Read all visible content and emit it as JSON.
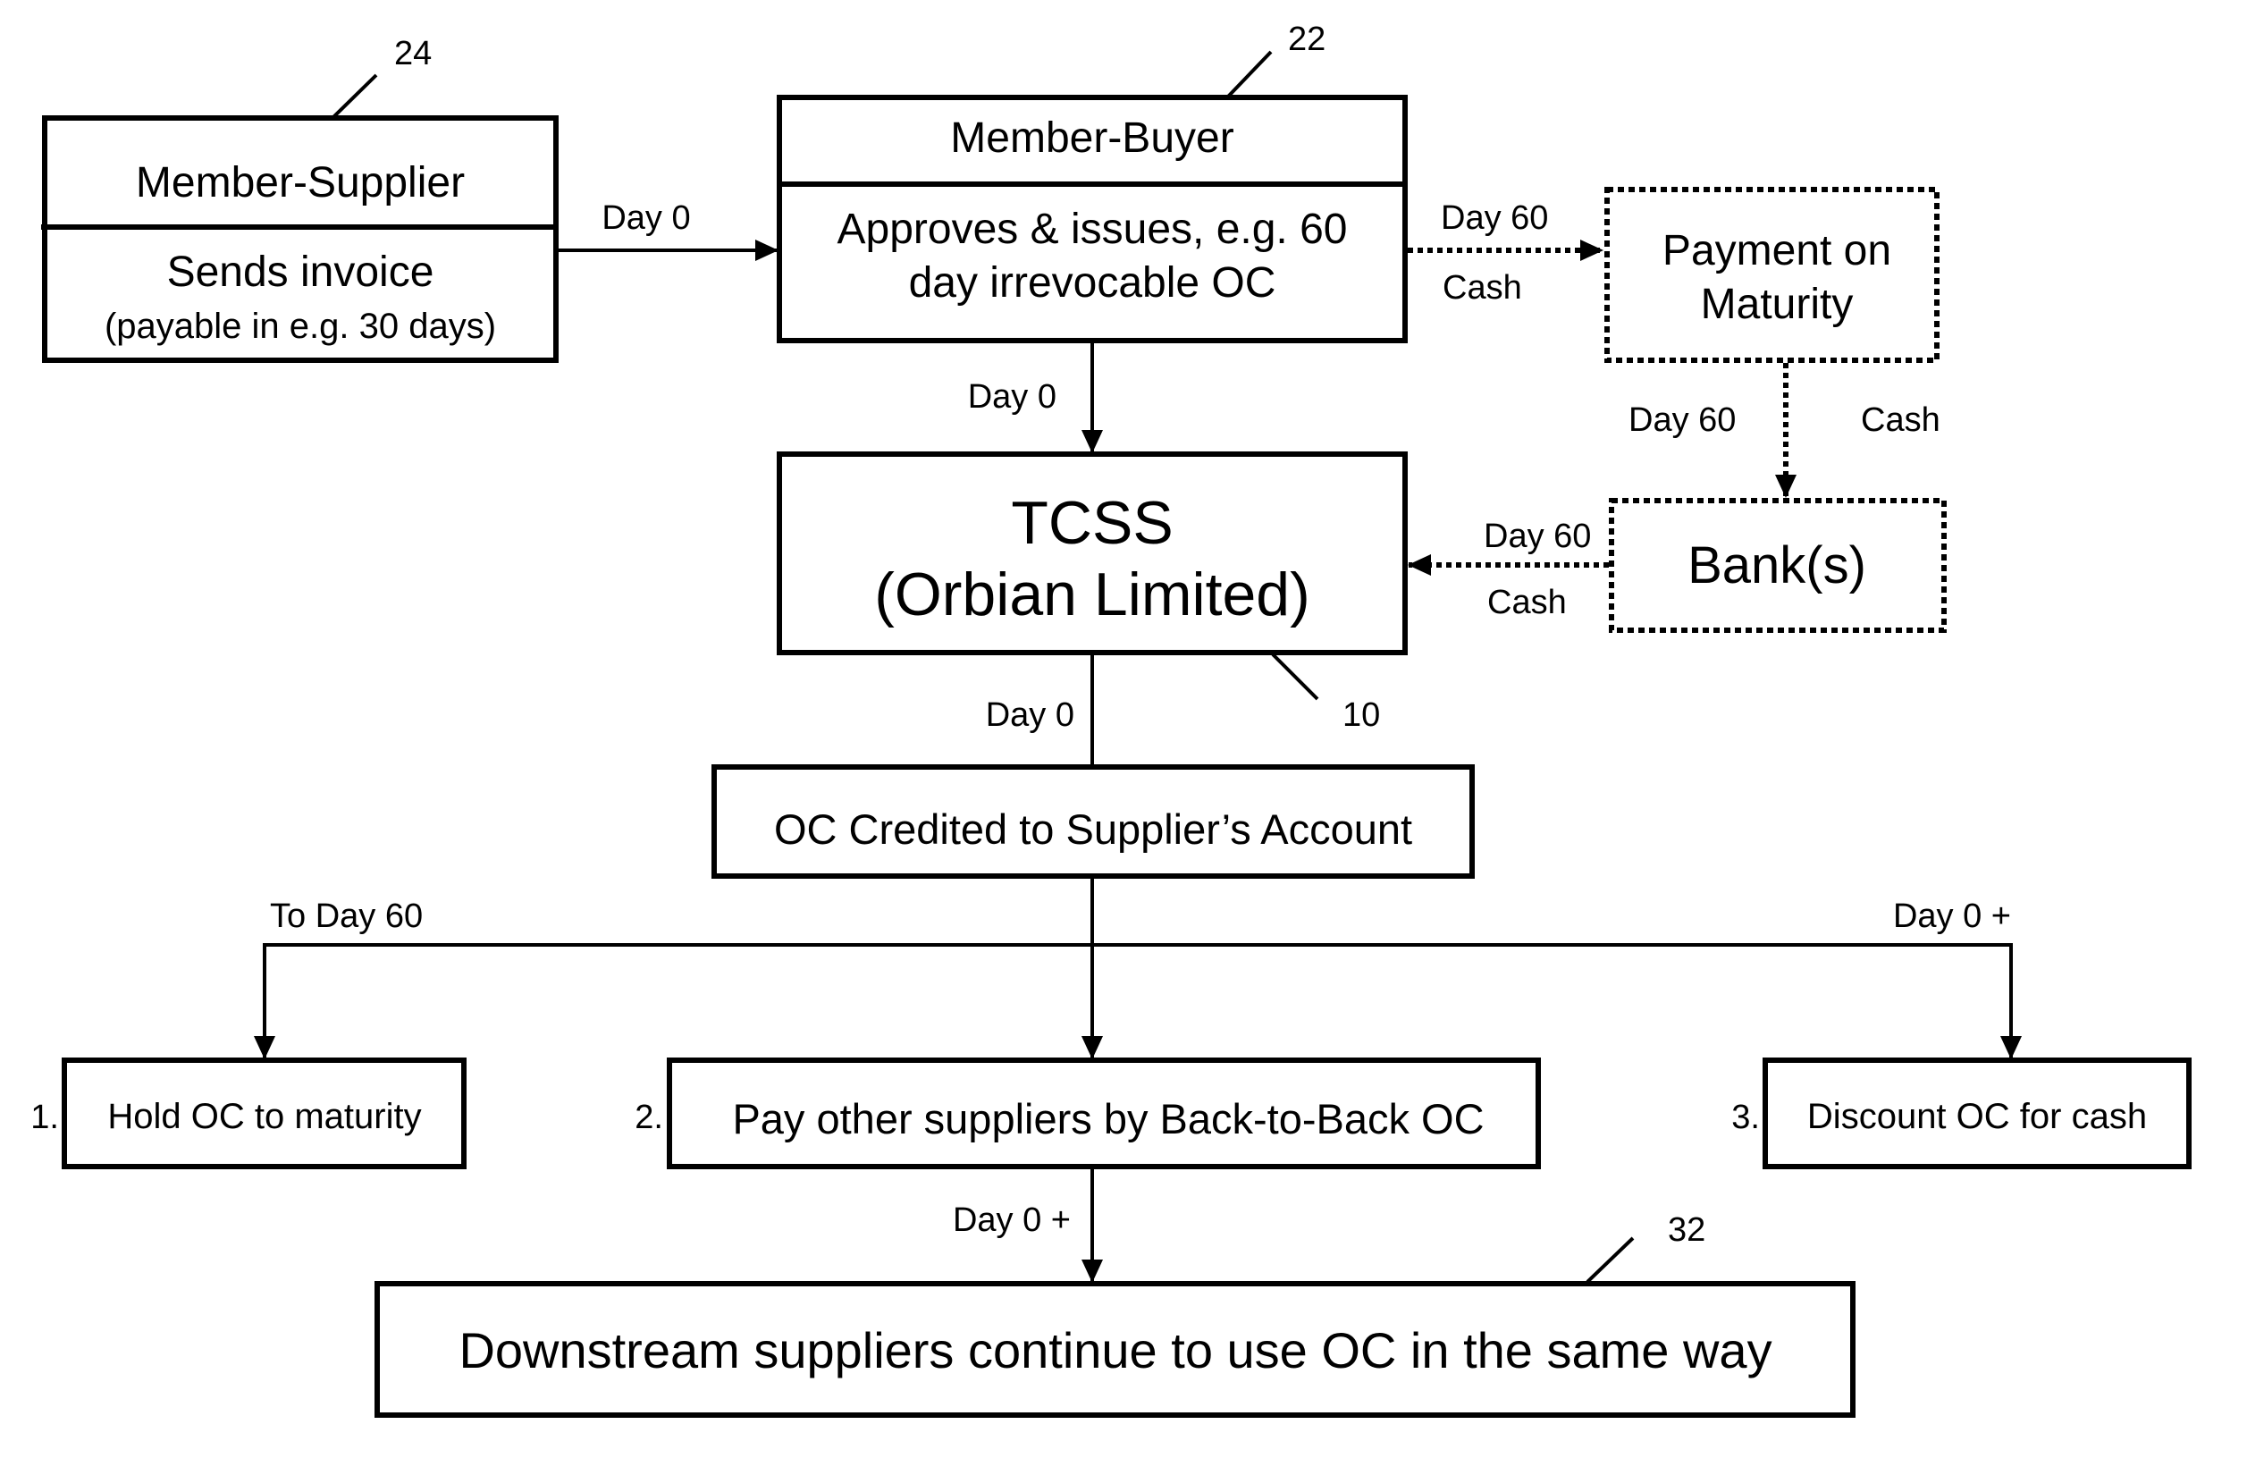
{
  "diagram": {
    "colors": {
      "ink": "#000000",
      "background": "#ffffff"
    },
    "nodes": {
      "supplier": {
        "ref": "24",
        "title": "Member-Supplier",
        "line1": "Sends invoice",
        "line2": "(payable in e.g. 30 days)"
      },
      "buyer": {
        "ref": "22",
        "title": "Member-Buyer",
        "line1": "Approves & issues, e.g. 60",
        "line2": "day irrevocable OC"
      },
      "payment": {
        "line1": "Payment on",
        "line2": "Maturity"
      },
      "banks": {
        "label": "Bank(s)"
      },
      "tcss": {
        "ref": "10",
        "line1": "TCSS",
        "line2": "(Orbian Limited)"
      },
      "oc_credited": {
        "label": "OC Credited to Supplier’s Account"
      },
      "option1": {
        "number": "1.",
        "label": "Hold OC to maturity"
      },
      "option2": {
        "number": "2.",
        "label": "Pay other suppliers by Back-to-Back OC"
      },
      "option3": {
        "number": "3.",
        "label": "Discount OC for cash"
      },
      "downstream": {
        "ref": "32",
        "label": "Downstream suppliers continue to use OC in the same way"
      }
    },
    "edges": {
      "supplier_to_buyer": {
        "label": "Day 0"
      },
      "buyer_to_payment": {
        "label_top": "Day 60",
        "label_bottom": "Cash"
      },
      "payment_to_banks": {
        "label_left": "Day 60",
        "label_right": "Cash"
      },
      "banks_to_tcss": {
        "label_top": "Day 60",
        "label_bottom": "Cash"
      },
      "buyer_to_tcss": {
        "label": "Day 0"
      },
      "tcss_to_oc": {
        "label": "Day 0"
      },
      "to_option1": {
        "label": "To Day 60"
      },
      "to_option3": {
        "label": "Day 0 +"
      },
      "option2_to_downstream": {
        "label": "Day 0 +"
      }
    }
  }
}
